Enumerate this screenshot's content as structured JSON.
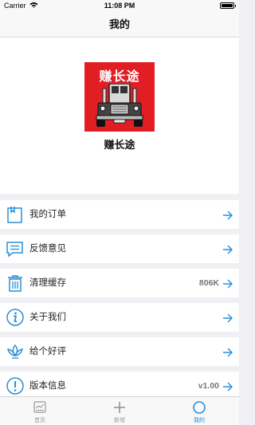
{
  "status_bar": {
    "carrier": "Carrier",
    "time": "11:08 PM"
  },
  "nav": {
    "title": "我的"
  },
  "profile": {
    "logo_text": "赚长途",
    "app_name": "赚长途"
  },
  "menu": [
    {
      "label": "我的订单",
      "value": "",
      "icon": "clipboard-icon"
    },
    {
      "label": "反馈意见",
      "value": "",
      "icon": "message-icon"
    },
    {
      "label": "清理缓存",
      "value": "806K",
      "icon": "trash-icon"
    },
    {
      "label": "关于我们",
      "value": "",
      "icon": "info-icon"
    },
    {
      "label": "给个好评",
      "value": "",
      "icon": "lotus-icon"
    },
    {
      "label": "版本信息",
      "value": "v1.00",
      "icon": "exclamation-icon"
    }
  ],
  "tabs": [
    {
      "label": "首页",
      "icon": "home-icon",
      "active": false
    },
    {
      "label": "新增",
      "icon": "plus-icon",
      "active": false
    },
    {
      "label": "我的",
      "icon": "circle-icon",
      "active": true
    }
  ],
  "colors": {
    "accent": "#2a8fd6",
    "logo_background": "#e01e24"
  }
}
